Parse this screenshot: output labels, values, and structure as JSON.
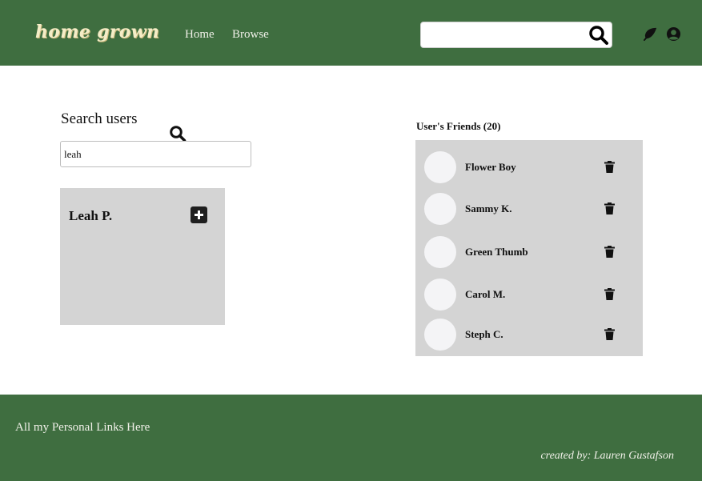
{
  "header": {
    "logo": "home grown",
    "nav": [
      {
        "label": "Home"
      },
      {
        "label": "Browse"
      }
    ],
    "search": {
      "value": "",
      "placeholder": "",
      "icon": "search-icon"
    },
    "icons": [
      "leaf-icon",
      "user-circle-icon"
    ]
  },
  "search_users": {
    "title": "Search users",
    "query": "leah",
    "results": [
      {
        "name": "Leah P."
      }
    ]
  },
  "friends": {
    "title": "User's Friends (20)",
    "list": [
      {
        "name": "Flower Boy"
      },
      {
        "name": "Sammy K."
      },
      {
        "name": "Green Thumb"
      },
      {
        "name": "Carol M."
      },
      {
        "name": "Steph C."
      }
    ]
  },
  "footer": {
    "links_text": "All my Personal Links Here",
    "credit": "created by: Lauren Gustafson"
  },
  "colors": {
    "brand_green": "#3f6e40",
    "panel_gray": "#d4d4d4",
    "logo_cream": "#f5edc7"
  }
}
